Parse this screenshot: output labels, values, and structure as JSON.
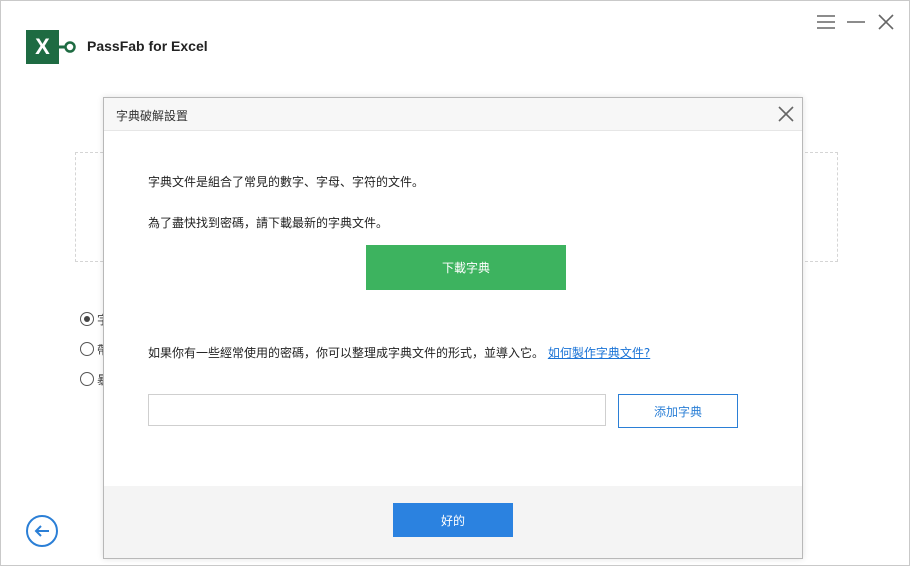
{
  "app": {
    "logo_letter": "X",
    "title": "PassFab for Excel",
    "accent": "#2b7fd6",
    "brand": "#1e6b42"
  },
  "window_controls": [
    {
      "name": "menu-icon"
    },
    {
      "name": "minimize-icon"
    },
    {
      "name": "close-icon"
    }
  ],
  "background": {
    "radio_options": [
      {
        "label": "字",
        "selected": true
      },
      {
        "label": "帶",
        "selected": false
      },
      {
        "label": "暴",
        "selected": false
      }
    ]
  },
  "dialog": {
    "title": "字典破解設置",
    "line1": "字典文件是組合了常見的數字、字母、字符的文件。",
    "line2": "為了盡快找到密碼，請下載最新的字典文件。",
    "download_label": "下載字典",
    "download_color": "#3db35f",
    "import_text": "如果你有一些經常使用的密碼，你可以整理成字典文件的形式，並導入它。",
    "help_link": "如何製作字典文件?",
    "input_value": "",
    "add_label": "添加字典",
    "ok_label": "好的",
    "ok_color": "#2b82e0"
  }
}
